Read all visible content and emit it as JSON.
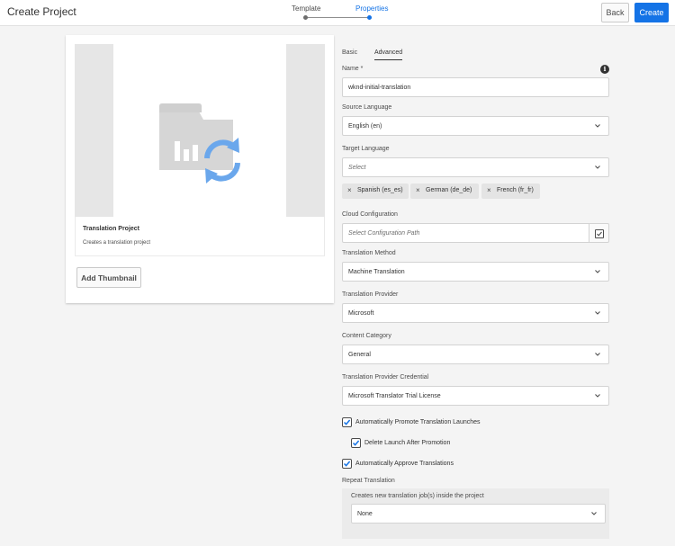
{
  "header": {
    "title": "Create Project",
    "steps": [
      {
        "label": "Template",
        "state": "done"
      },
      {
        "label": "Properties",
        "state": "current"
      }
    ],
    "back_label": "Back",
    "create_label": "Create",
    "accent": "#1473e6"
  },
  "template_card": {
    "name": "Translation Project",
    "description": "Creates a translation project",
    "add_thumbnail_label": "Add Thumbnail"
  },
  "tabs": [
    {
      "label": "Basic",
      "selected": false
    },
    {
      "label": "Advanced",
      "selected": true
    }
  ],
  "form": {
    "name": {
      "label": "Name *",
      "value": "wknd-initial-translation"
    },
    "source_language": {
      "label": "Source Language",
      "value": "English (en)"
    },
    "target_language": {
      "label": "Target Language",
      "placeholder": "Select",
      "tags": [
        "Spanish (es_es)",
        "German (de_de)",
        "French (fr_fr)"
      ]
    },
    "cloud_configuration": {
      "label": "Cloud Configuration",
      "placeholder": "Select Configuration Path"
    },
    "translation_method": {
      "label": "Translation Method",
      "value": "Machine Translation"
    },
    "translation_provider": {
      "label": "Translation Provider",
      "value": "Microsoft"
    },
    "content_category": {
      "label": "Content Category",
      "value": "General"
    },
    "provider_credential": {
      "label": "Translation Provider Credential",
      "value": "Microsoft Translator Trial License"
    },
    "checkboxes": [
      {
        "label": "Automatically Promote Translation Launches",
        "checked": true
      },
      {
        "label": "Delete Launch After Promotion",
        "checked": true
      },
      {
        "label": "Automatically Approve Translations",
        "checked": true
      }
    ],
    "repeat_translation": {
      "label": "Repeat Translation",
      "sublabel": "Creates new translation job(s) inside the project",
      "value": "None"
    }
  }
}
